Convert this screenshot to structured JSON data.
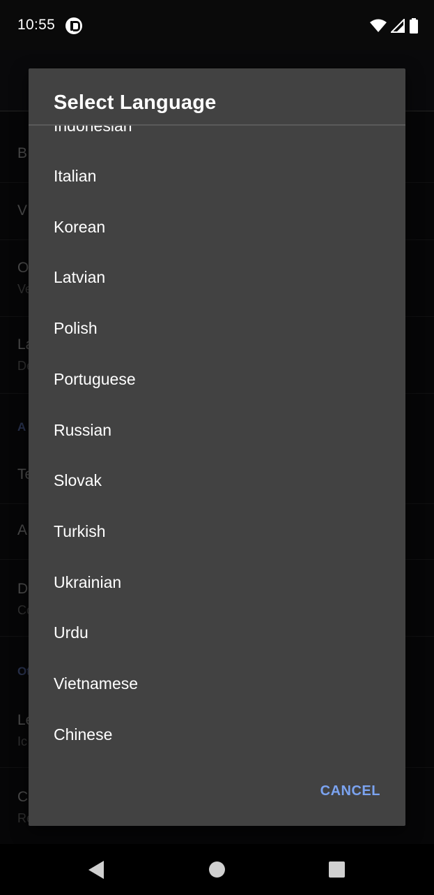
{
  "status_bar": {
    "time": "10:55",
    "icons": [
      "app-notification-icon",
      "wifi-icon",
      "cellular-signal-icon",
      "battery-icon"
    ]
  },
  "background": {
    "rows": [
      {
        "title": "B"
      },
      {
        "title": "V"
      },
      {
        "title": "O",
        "subtitle": "Ve"
      },
      {
        "title": "La",
        "subtitle": "De"
      },
      {
        "section": "A"
      },
      {
        "title": "Te"
      },
      {
        "title": "A"
      },
      {
        "title": "D",
        "subtitle": "Cc"
      },
      {
        "section": "Ot"
      },
      {
        "title": "Le",
        "subtitle": "Ic"
      },
      {
        "title": "C",
        "subtitle": "Re"
      }
    ]
  },
  "dialog": {
    "title": "Select Language",
    "languages": [
      "Indonesian",
      "Italian",
      "Korean",
      "Latvian",
      "Polish",
      "Portuguese",
      "Russian",
      "Slovak",
      "Turkish",
      "Ukrainian",
      "Urdu",
      "Vietnamese",
      "Chinese"
    ],
    "cancel_label": "CANCEL"
  },
  "colors": {
    "dialog_bg": "#424242",
    "accent": "#7ba3f0",
    "text_primary": "#ffffff"
  }
}
